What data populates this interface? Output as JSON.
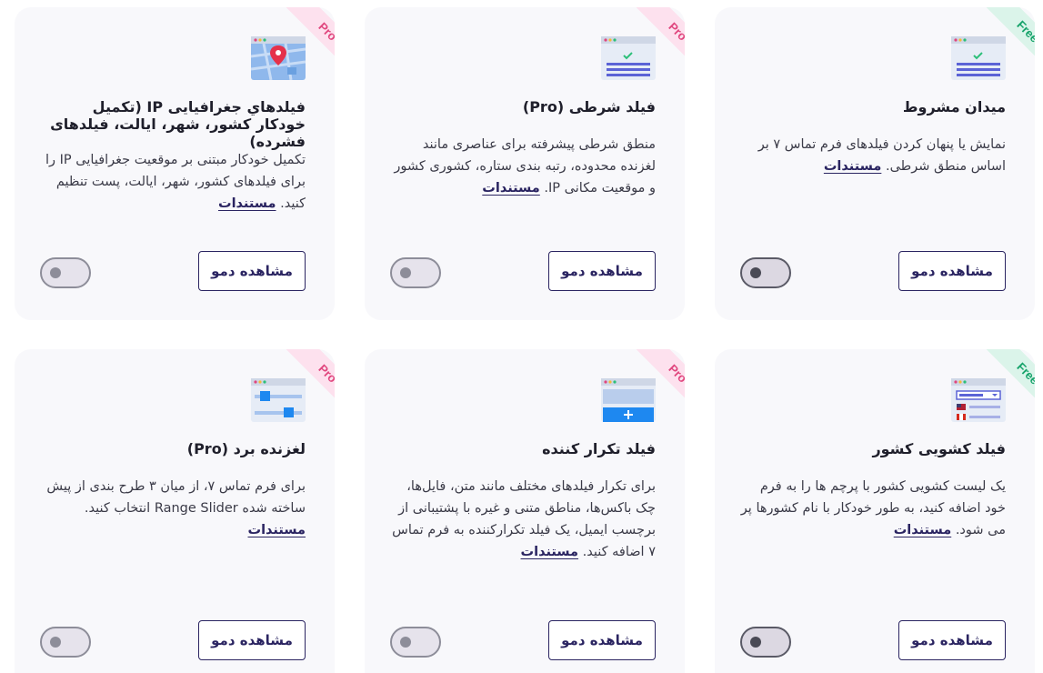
{
  "docs_label": "مستندات",
  "demo_label": "مشاهده دمو",
  "cards": [
    {
      "badge": "Free",
      "title": "میدان مشروط",
      "desc": "نمایش یا پنهان کردن فیلدهای فرم تماس ۷ بر اساس منطق شرطی.",
      "toggle_on": false
    },
    {
      "badge": "Pro",
      "title": "فیلد شرطی (Pro)",
      "desc": "منطق شرطی پیشرفته برای عناصری مانند لغزنده محدوده، رتبه بندی ستاره، کشوری کشور و موقعیت مکانی IP.",
      "toggle_on": false
    },
    {
      "badge": "Pro",
      "title": "فیلدهاي جغرافیایی IP (تکمیل خودکار کشور، شهر، ایالت، فیلدهای فشرده)",
      "desc": "تکمیل خودکار مبتنی بر موقعیت جغرافیایی IP را برای فیلدهای کشور، شهر، ایالت، پست تنظیم کنید.",
      "toggle_on": false
    },
    {
      "badge": "Free",
      "title": "فیلد کشویی کشور",
      "desc": "یک لیست کشویی کشور با پرچم ها را به فرم خود اضافه کنید، به طور خودکار با نام کشورها پر می شود.",
      "toggle_on": false
    },
    {
      "badge": "Pro",
      "title": "فیلد تکرار کننده",
      "desc": "برای تکرار فیلدهای مختلف مانند متن، فایل‌ها، چک باکس‌ها، مناطق متنی و غیره با پشتیبانی از برچسب ایمیل، یک فیلد تکرارکننده به فرم تماس ۷ اضافه کنید.",
      "toggle_on": false
    },
    {
      "badge": "Pro",
      "title": "لغزنده برد (Pro)",
      "desc": "برای فرم تماس ۷، از میان ۳ طرح بندی از پیش ساخته شده Range Slider انتخاب کنید.",
      "toggle_on": false
    }
  ],
  "colors": {
    "accent": "#2a2461",
    "pro_ribbon": "#fde1ee",
    "pro_text": "#e0467e",
    "free_ribbon": "#dbf4ea",
    "free_text": "#16a36a",
    "card_bg": "#f8f8fb"
  },
  "icons": [
    "conditional-form-icon",
    "conditional-form-icon",
    "map-pin-icon",
    "country-flag-dropdown-icon",
    "repeater-plus-icon",
    "range-slider-icon"
  ]
}
